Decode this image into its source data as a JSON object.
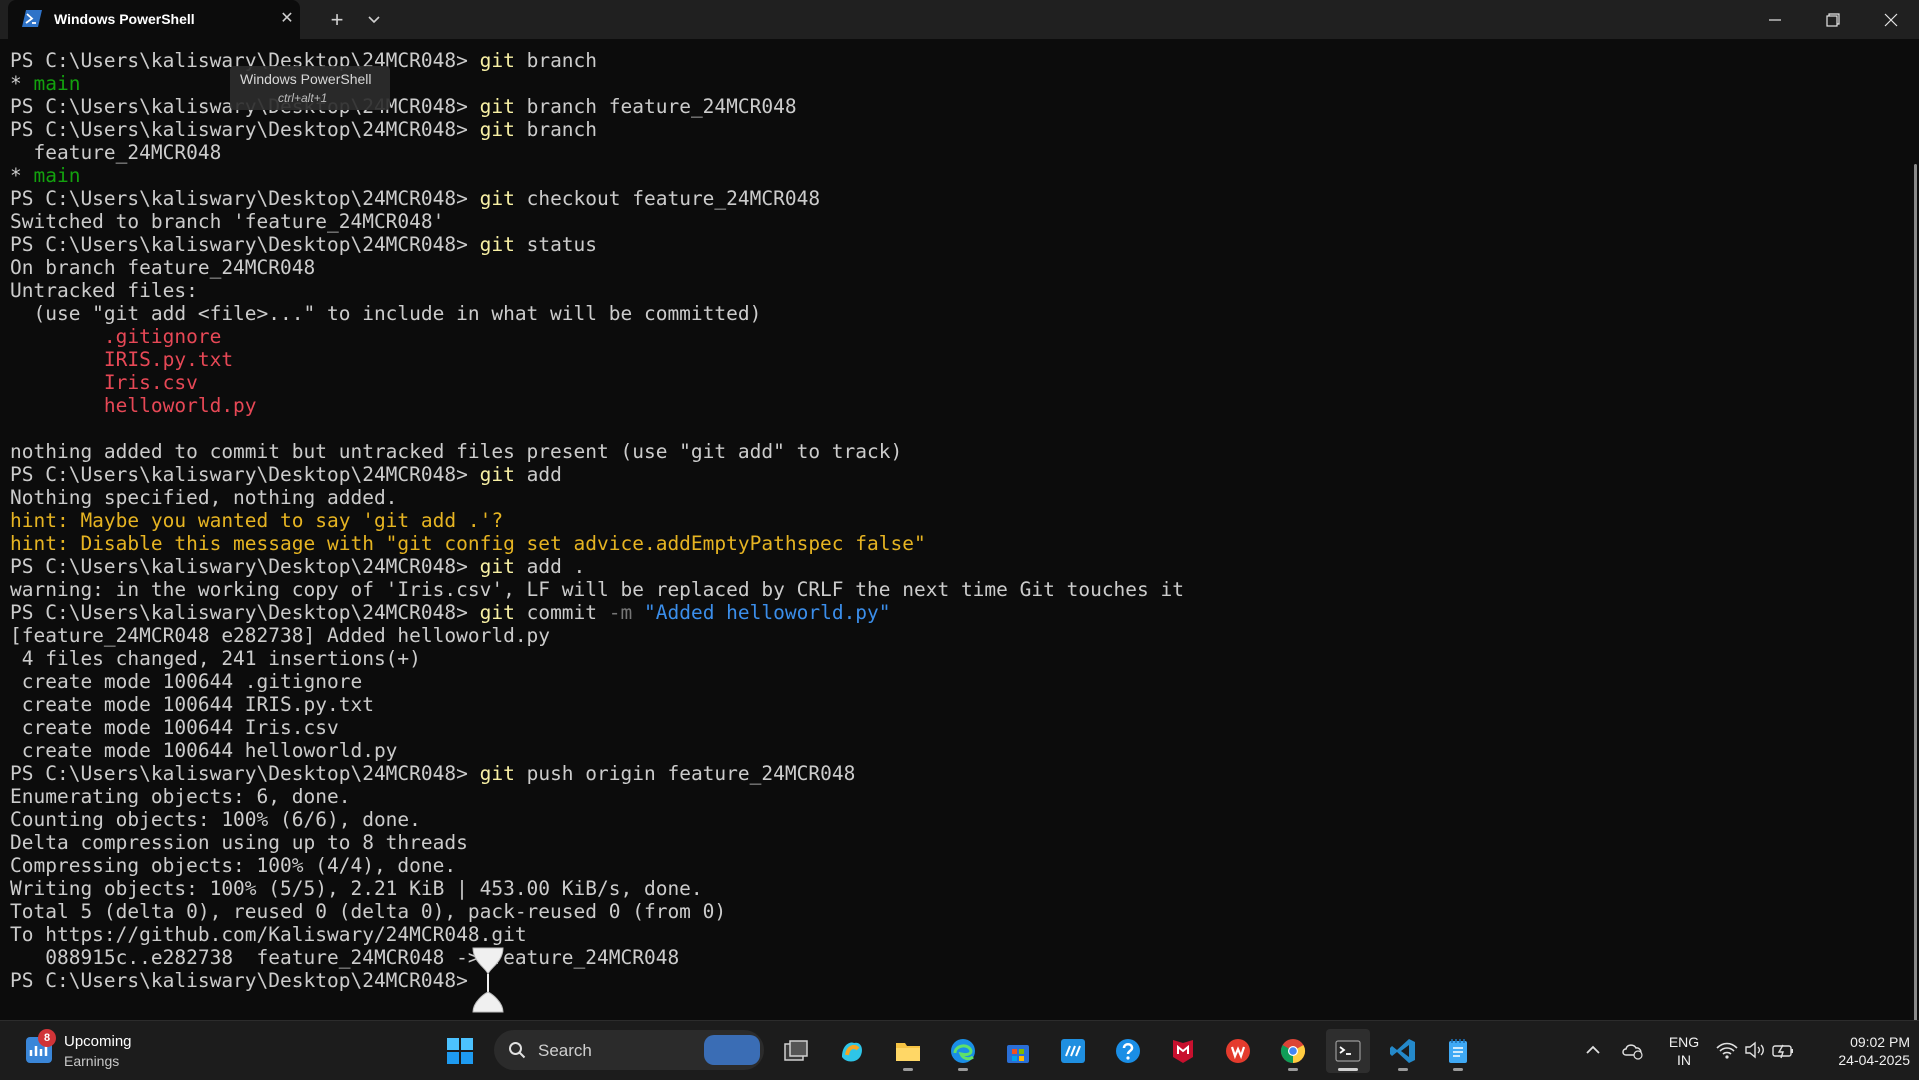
{
  "window": {
    "tab_title": "Windows PowerShell",
    "tooltip_title": "Windows PowerShell",
    "tooltip_shortcut": "ctrl+alt+1"
  },
  "terminal": {
    "lines": [
      [
        {
          "t": "PS C:\\Users\\kaliswary\\Desktop\\24MCR048> ",
          "c": "default"
        },
        {
          "t": "git",
          "c": "cmd"
        },
        {
          "t": " branch",
          "c": "default"
        }
      ],
      [
        {
          "t": "* ",
          "c": "default"
        },
        {
          "t": "main",
          "c": "green"
        }
      ],
      [
        {
          "t": "PS C:\\Users\\kaliswary\\Desktop\\24MCR048> ",
          "c": "default"
        },
        {
          "t": "git",
          "c": "cmd"
        },
        {
          "t": " branch feature_24MCR048",
          "c": "default"
        }
      ],
      [
        {
          "t": "PS C:\\Users\\kaliswary\\Desktop\\24MCR048> ",
          "c": "default"
        },
        {
          "t": "git",
          "c": "cmd"
        },
        {
          "t": " branch",
          "c": "default"
        }
      ],
      [
        {
          "t": "  feature_24MCR048",
          "c": "default"
        }
      ],
      [
        {
          "t": "* ",
          "c": "default"
        },
        {
          "t": "main",
          "c": "green"
        }
      ],
      [
        {
          "t": "PS C:\\Users\\kaliswary\\Desktop\\24MCR048> ",
          "c": "default"
        },
        {
          "t": "git",
          "c": "cmd"
        },
        {
          "t": " checkout feature_24MCR048",
          "c": "default"
        }
      ],
      [
        {
          "t": "Switched to branch 'feature_24MCR048'",
          "c": "default"
        }
      ],
      [
        {
          "t": "PS C:\\Users\\kaliswary\\Desktop\\24MCR048> ",
          "c": "default"
        },
        {
          "t": "git",
          "c": "cmd"
        },
        {
          "t": " status",
          "c": "default"
        }
      ],
      [
        {
          "t": "On branch feature_24MCR048",
          "c": "default"
        }
      ],
      [
        {
          "t": "Untracked files:",
          "c": "default"
        }
      ],
      [
        {
          "t": "  (use \"git add <file>...\" to include in what will be committed)",
          "c": "default"
        }
      ],
      [
        {
          "t": "        .gitignore",
          "c": "red"
        }
      ],
      [
        {
          "t": "        IRIS.py.txt",
          "c": "red"
        }
      ],
      [
        {
          "t": "        Iris.csv",
          "c": "red"
        }
      ],
      [
        {
          "t": "        helloworld.py",
          "c": "red"
        }
      ],
      [
        {
          "t": "",
          "c": "default"
        }
      ],
      [
        {
          "t": "nothing added to commit but untracked files present (use \"git add\" to track)",
          "c": "default"
        }
      ],
      [
        {
          "t": "PS C:\\Users\\kaliswary\\Desktop\\24MCR048> ",
          "c": "default"
        },
        {
          "t": "git",
          "c": "cmd"
        },
        {
          "t": " add",
          "c": "default"
        }
      ],
      [
        {
          "t": "Nothing specified, nothing added.",
          "c": "default"
        }
      ],
      [
        {
          "t": "hint: Maybe you wanted to say 'git add .'?",
          "c": "yellow"
        }
      ],
      [
        {
          "t": "hint: Disable this message with \"git config set advice.addEmptyPathspec false\"",
          "c": "yellow"
        }
      ],
      [
        {
          "t": "PS C:\\Users\\kaliswary\\Desktop\\24MCR048> ",
          "c": "default"
        },
        {
          "t": "git",
          "c": "cmd"
        },
        {
          "t": " add .",
          "c": "default"
        }
      ],
      [
        {
          "t": "warning: in the working copy of 'Iris.csv', LF will be replaced by CRLF the next time Git touches it",
          "c": "default"
        }
      ],
      [
        {
          "t": "PS C:\\Users\\kaliswary\\Desktop\\24MCR048> ",
          "c": "default"
        },
        {
          "t": "git",
          "c": "cmd"
        },
        {
          "t": " commit ",
          "c": "default"
        },
        {
          "t": "-m",
          "c": "param"
        },
        {
          "t": " \"Added helloworld.py\"",
          "c": "string"
        }
      ],
      [
        {
          "t": "[feature_24MCR048 e282738] Added helloworld.py",
          "c": "default"
        }
      ],
      [
        {
          "t": " 4 files changed, 241 insertions(+)",
          "c": "default"
        }
      ],
      [
        {
          "t": " create mode 100644 .gitignore",
          "c": "default"
        }
      ],
      [
        {
          "t": " create mode 100644 IRIS.py.txt",
          "c": "default"
        }
      ],
      [
        {
          "t": " create mode 100644 Iris.csv",
          "c": "default"
        }
      ],
      [
        {
          "t": " create mode 100644 helloworld.py",
          "c": "default"
        }
      ],
      [
        {
          "t": "PS C:\\Users\\kaliswary\\Desktop\\24MCR048> ",
          "c": "default"
        },
        {
          "t": "git",
          "c": "cmd"
        },
        {
          "t": " push origin feature_24MCR048",
          "c": "default"
        }
      ],
      [
        {
          "t": "Enumerating objects: 6, done.",
          "c": "default"
        }
      ],
      [
        {
          "t": "Counting objects: 100% (6/6), done.",
          "c": "default"
        }
      ],
      [
        {
          "t": "Delta compression using up to 8 threads",
          "c": "default"
        }
      ],
      [
        {
          "t": "Compressing objects: 100% (4/4), done.",
          "c": "default"
        }
      ],
      [
        {
          "t": "Writing objects: 100% (5/5), 2.21 KiB | 453.00 KiB/s, done.",
          "c": "default"
        }
      ],
      [
        {
          "t": "Total 5 (delta 0), reused 0 (delta 0), pack-reused 0 (from 0)",
          "c": "default"
        }
      ],
      [
        {
          "t": "To https://github.com/Kaliswary/24MCR048.git",
          "c": "default"
        }
      ],
      [
        {
          "t": "   088915c..e282738  feature_24MCR048 -> feature_24MCR048",
          "c": "default"
        }
      ],
      [
        {
          "t": "PS C:\\Users\\kaliswary\\Desktop\\24MCR048> ",
          "c": "default"
        }
      ]
    ],
    "colors": {
      "default": "#cccccc",
      "cmd": "#f9f1a5",
      "param": "#767676",
      "string": "#3b8eea",
      "red": "#e74856",
      "yellow": "#e6b422",
      "green": "#13a10e"
    }
  },
  "taskbar": {
    "widget": {
      "badge": "8",
      "title": "Upcoming",
      "subtitle": "Earnings"
    },
    "search_label": "Search",
    "pinned_icons": [
      "start-icon",
      "task-view-icon",
      "copilot-icon",
      "file-explorer-icon",
      "edge-icon",
      "store-icon",
      "myhp-icon",
      "help-icon",
      "mcafee-icon",
      "wps-office-icon",
      "chrome-icon",
      "terminal-icon",
      "vscode-icon",
      "notepad-icon"
    ],
    "tray": {
      "lang_line1": "ENG",
      "lang_line2": "IN",
      "time": "09:02 PM",
      "date": "24-04-2025"
    }
  }
}
